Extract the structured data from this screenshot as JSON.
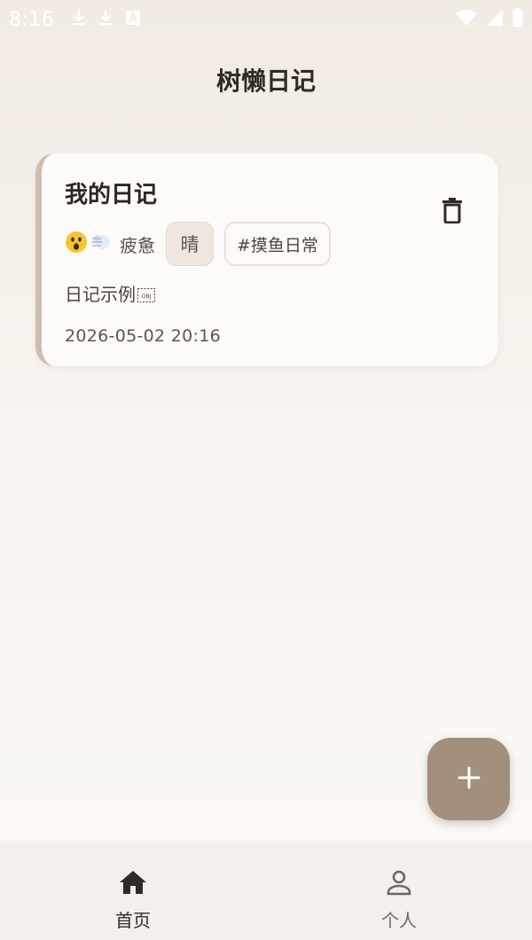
{
  "status_bar": {
    "time": "8:16",
    "left_icons": [
      "download-icon",
      "download-icon",
      "font-a-icon"
    ],
    "right_icons": [
      "wifi-icon",
      "cell-signal-icon",
      "battery-icon"
    ]
  },
  "header": {
    "title": "树懒日记"
  },
  "diary_entries": [
    {
      "title": "我的日记",
      "mood_emojis": [
        "😮",
        "💨"
      ],
      "mood_label": "疲惫",
      "weather": "晴",
      "tag": "#摸鱼日常",
      "body": "日记示例",
      "datetime": "2026-05-02 20:16",
      "delete_icon": "trash-icon"
    }
  ],
  "fab": {
    "icon": "plus-icon"
  },
  "bottom_nav": {
    "items": [
      {
        "label": "首页",
        "icon": "home-icon",
        "active": true
      },
      {
        "label": "个人",
        "icon": "person-icon",
        "active": false
      }
    ]
  },
  "colors": {
    "accent": "#a28f7d",
    "card_border": "#cdbfb0",
    "card_bg": "#fdfbf8",
    "page_bg_top": "#f1ebe3",
    "nav_bg": "#f4efea"
  }
}
